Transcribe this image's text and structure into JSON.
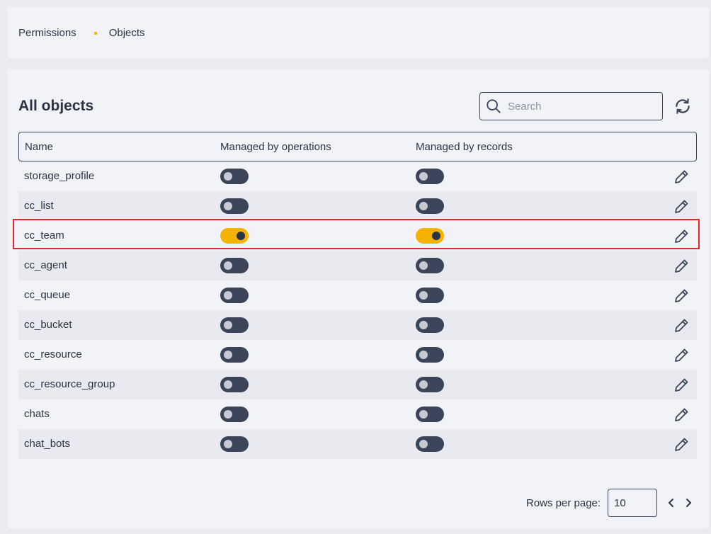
{
  "breadcrumb": {
    "items": [
      "Permissions",
      "Objects"
    ]
  },
  "page": {
    "title": "All objects"
  },
  "search": {
    "placeholder": "Search",
    "value": ""
  },
  "table": {
    "columns": [
      "Name",
      "Managed by operations",
      "Managed by records"
    ],
    "rows": [
      {
        "name": "storage_profile",
        "operations": false,
        "records": false
      },
      {
        "name": "cc_list",
        "operations": false,
        "records": false
      },
      {
        "name": "cc_team",
        "operations": true,
        "records": true,
        "highlighted": true
      },
      {
        "name": "cc_agent",
        "operations": false,
        "records": false
      },
      {
        "name": "cc_queue",
        "operations": false,
        "records": false
      },
      {
        "name": "cc_bucket",
        "operations": false,
        "records": false
      },
      {
        "name": "cc_resource",
        "operations": false,
        "records": false
      },
      {
        "name": "cc_resource_group",
        "operations": false,
        "records": false
      },
      {
        "name": "chats",
        "operations": false,
        "records": false
      },
      {
        "name": "chat_bots",
        "operations": false,
        "records": false
      }
    ]
  },
  "pagination": {
    "rows_per_page_label": "Rows per page:",
    "rows_per_page": "10"
  },
  "icons": {
    "search": "search-icon",
    "refresh": "refresh-icon",
    "edit": "pencil-icon",
    "prev": "chevron-left-icon",
    "next": "chevron-right-icon"
  },
  "colors": {
    "accent": "#f5b300",
    "highlight": "#e5262a",
    "toggle_off": "#3b4458"
  }
}
